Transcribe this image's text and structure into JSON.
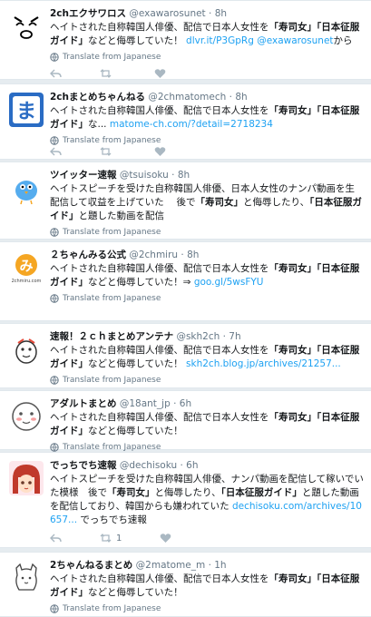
{
  "tweets": [
    {
      "name": "2chエクサワロス",
      "handle": "@exawarosunet",
      "dot": "·",
      "time": "8h",
      "text_plain": "ヘイトされた自称韓国人俳優、配信で日本人女性を",
      "text_b1": "「寿司女」",
      "text_b2": "「日本征服ガイド」",
      "text_tail": "などと侮辱していた！",
      "link": "dlvr.it/P3GpRg",
      "link2": "@exawarosunet",
      "link_suffix": "から",
      "translate": "Translate from Japanese",
      "retweets": ""
    },
    {
      "name": "2chまとめちゃんねる",
      "handle": "@2chmatomech",
      "dot": "·",
      "time": "8h",
      "text_plain": "ヘイトされた自称韓国人俳優、配信で日本人女性を",
      "text_b1": "「寿司女」",
      "text_b2": "「日本征服ガイド」",
      "text_tail": "な...",
      "link": "matome-ch.com/?detail=2718234",
      "translate": "Translate from Japanese",
      "retweets": ""
    },
    {
      "name": "ツイッター速報",
      "handle": "@tsuisoku",
      "dot": "·",
      "time": "8h",
      "text_plain": "ヘイトスピーチを受けた自称韓国人俳優、日本人女性のナンパ動画を生配信して収益を上げていた　 後で",
      "text_b1": "「寿司女」",
      "text_mid": "と侮辱したり、",
      "text_b2": "「日本征服ガイド」",
      "text_tail": "と題した動画を配信",
      "translate": "Translate from Japanese",
      "retweets": ""
    },
    {
      "name": "２ちゃんみる公式",
      "handle": "@2chmiru",
      "dot": "·",
      "time": "8h",
      "text_plain": "ヘイトされた自称韓国人俳優、配信で日本人女性を",
      "text_b1": "「寿司女」",
      "text_b2": "「日本征服ガイド」",
      "text_tail": "などと侮辱していた！⇒",
      "link": "goo.gl/5wsFYU",
      "translate": "Translate from Japanese",
      "retweets": ""
    },
    {
      "name": "速報！２ｃｈまとめアンテナ",
      "handle": "@skh2ch",
      "dot": "·",
      "time": "7h",
      "text_plain": "ヘイトされた自称韓国人俳優、配信で日本人女性を",
      "text_b1": "「寿司女」",
      "text_b2": "「日本征服ガイド」",
      "text_tail": "などと侮辱していた！",
      "link": "skh2ch.blog.jp/archives/21257...",
      "translate": "Translate from Japanese",
      "retweets": ""
    },
    {
      "name": "アダルトまとめ",
      "handle": "@18ant_jp",
      "dot": "·",
      "time": "6h",
      "text_plain": "ヘイトされた自称韓国人俳優、配信で日本人女性を",
      "text_b1": "「寿司女」",
      "text_b2": "「日本征服ガイド」",
      "text_tail": "などと侮辱していた！",
      "translate": "Translate from Japanese",
      "retweets": ""
    },
    {
      "name": "でっちでち速報",
      "handle": "@dechisoku",
      "dot": "·",
      "time": "6h",
      "text_plain": "ヘイトスピーチを受けた自称韓国人俳優、ナンパ動画を配信して稼いでいた模様　後で",
      "text_b1": "「寿司女」",
      "text_mid": "と侮辱したり、",
      "text_b2": "「日本征服ガイド」",
      "text_tail": "と題した動画を配信しており、韓国からも嫌われていた",
      "link": "dechisoku.com/archives/10657...",
      "link_suffix": "でっちでち速報",
      "translate": "Translate from Japanese",
      "retweets": "1"
    },
    {
      "name": "2ちゃんねるまとめ",
      "handle": "@2matome_m",
      "dot": "·",
      "time": "1h",
      "text_plain": "ヘイトされた自称韓国人俳優、配信で日本人女性を",
      "text_b1": "「寿司女」",
      "text_b2": "「日本征服ガイド」",
      "text_tail": "などと侮辱していた！",
      "translate": "Translate from Japanese",
      "retweets": ""
    }
  ],
  "avatar_badges": {
    "matome": "ま",
    "miru": "み",
    "miru_sub": "2chmiru.com"
  },
  "colors": {
    "link": "#1da1f2",
    "muted": "#657786",
    "icon": "#aab8c2",
    "background": "#e6ecf0"
  },
  "icons": [
    "globe-icon",
    "reply-icon",
    "retweet-icon",
    "like-icon"
  ]
}
